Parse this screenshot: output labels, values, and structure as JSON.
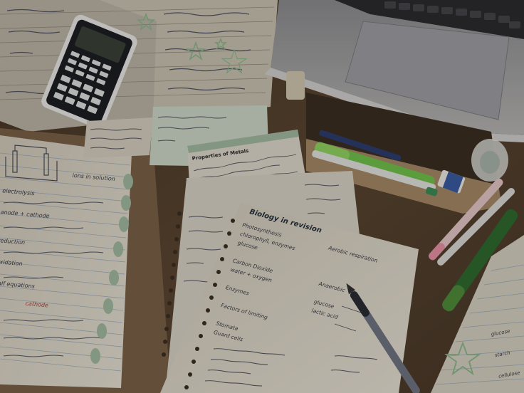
{
  "scene": {
    "description_tags": [
      "desk",
      "study-notes",
      "laptop",
      "calculator",
      "index-cards",
      "pens",
      "highlighters",
      "binder"
    ],
    "colors": {
      "desk": "#5a4531",
      "paper": "#d9d3c4",
      "ruled_line": "#9aa9b6",
      "ink": "#3a3a44",
      "highlighter_green": "#6fbf4a",
      "pen_dark_green": "#2f6a2e",
      "binder_tab": "#9fb79e",
      "doodle_star": "#8ab58a"
    }
  },
  "notes": {
    "main_title": "Biology in revision",
    "calculator_brand": "",
    "cards_title": "Properties of Metals"
  },
  "handwriting": {
    "main_sheet": [
      "Photosynthesis",
      "chlorophyll, enzymes",
      "glucose",
      "Aerobic respiration",
      "Carbon Dioxide",
      "water + oxygen",
      "Enzymes",
      "Anaerobic",
      "Factors of limiting",
      "glucose",
      "lactic acid",
      "Stomata",
      "Guard cells"
    ],
    "left_notes": [
      "ions in solution",
      "electrolysis",
      "anode + cathode",
      "reduction",
      "oxidation",
      "half equations"
    ],
    "left_red_note": "cathode",
    "right_pink_note": "",
    "bottom_right_notes": [
      "glucose",
      "starch",
      "cellulose"
    ]
  },
  "objects": {
    "highlighter_label": "",
    "eraser_label": ""
  }
}
